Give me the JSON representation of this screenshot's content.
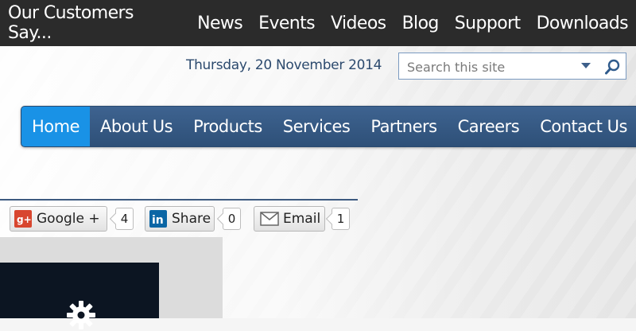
{
  "topnav": {
    "items": [
      "Our Customers Say...",
      "News",
      "Events",
      "Videos",
      "Blog",
      "Support",
      "Downloads"
    ]
  },
  "header": {
    "date": "Thursday, 20 November 2014",
    "search": {
      "placeholder": "Search this site"
    }
  },
  "mainnav": {
    "items": [
      "Home",
      "About Us",
      "Products",
      "Services",
      "Partners",
      "Careers",
      "Contact Us"
    ],
    "active": "Home"
  },
  "share": {
    "google": {
      "label": "Google +",
      "count": "4"
    },
    "linkedin": {
      "label": "Share",
      "count": "0"
    },
    "email": {
      "label": "Email",
      "count": "1"
    }
  },
  "colors": {
    "topbar": "#2b2b2b",
    "nav": "#335a86",
    "nav_active": "#1992e6",
    "date_text": "#2c4a6e"
  },
  "icons": [
    "google-plus-icon",
    "linkedin-icon",
    "envelope-icon",
    "search-icon",
    "dropdown-arrow-icon",
    "gear-icon"
  ]
}
